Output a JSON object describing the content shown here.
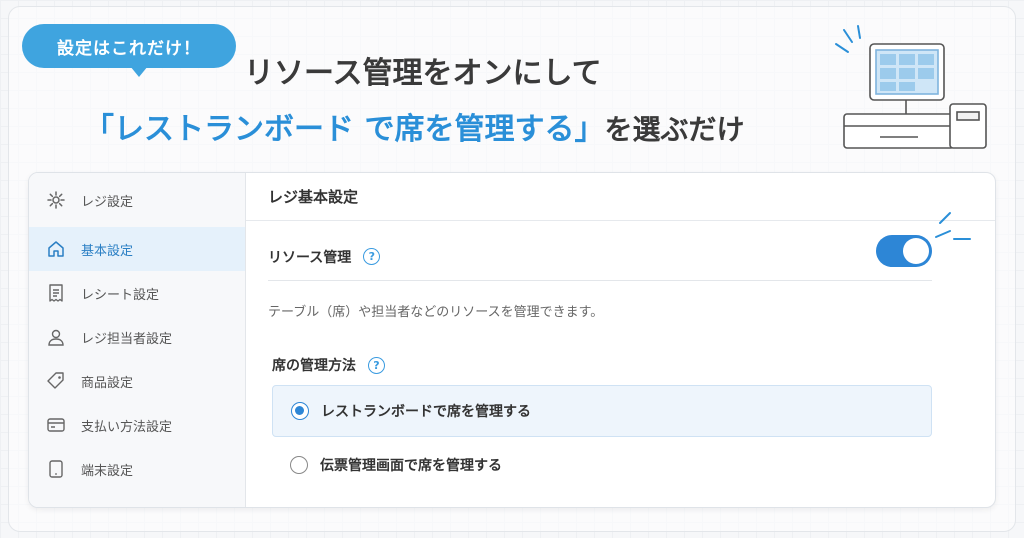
{
  "banner": {
    "badge": "設定はこれだけ！",
    "headline_line1": "リソース管理をオンにして",
    "headline_highlight": "「レストランボード で席を管理する」",
    "headline_rest": "を選ぶだけ"
  },
  "sidebar": {
    "items": [
      {
        "label": "レジ設定",
        "icon": "gear-icon",
        "active": false
      },
      {
        "label": "基本設定",
        "icon": "home-icon",
        "active": true
      },
      {
        "label": "レシート設定",
        "icon": "receipt-icon",
        "active": false
      },
      {
        "label": "レジ担当者設定",
        "icon": "user-icon",
        "active": false
      },
      {
        "label": "商品設定",
        "icon": "tag-icon",
        "active": false
      },
      {
        "label": "支払い方法設定",
        "icon": "card-icon",
        "active": false
      },
      {
        "label": "端末設定",
        "icon": "tablet-icon",
        "active": false
      }
    ]
  },
  "main": {
    "title": "レジ基本設定",
    "resource_label": "リソース管理",
    "resource_toggle_on": true,
    "description": "テーブル（席）や担当者などのリソースを管理できます。",
    "method_label": "席の管理方法",
    "options": [
      {
        "label": "レストランボードで席を管理する",
        "selected": true
      },
      {
        "label": "伝票管理画面で席を管理する",
        "selected": false
      }
    ]
  },
  "colors": {
    "accent": "#2d86d6",
    "badge": "#3fa4df",
    "highlight_text": "#2a8fd8"
  }
}
